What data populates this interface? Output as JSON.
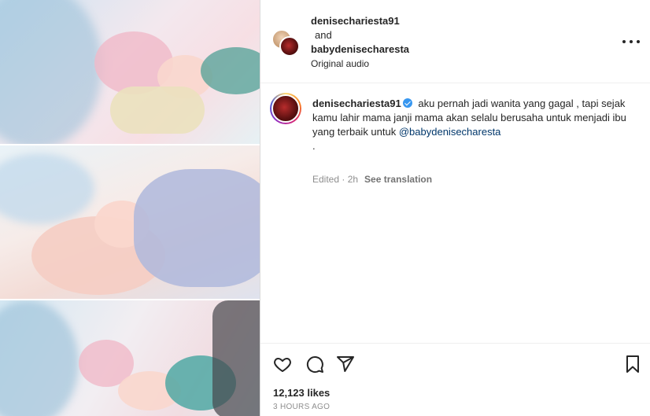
{
  "header": {
    "user1": "denisechariesta91",
    "joiner": "and",
    "user2": "babydenisecharesta",
    "audio": "Original audio"
  },
  "caption": {
    "username": "denisechariesta91",
    "text": "aku pernah jadi wanita yang gagal , tapi sejak kamu lahir mama janji mama akan selalu berusaha untuk menjadi ibu yang terbaik untuk",
    "mention": "@babydenisecharesta",
    "trailing": "."
  },
  "meta": {
    "edited": "Edited · 2h",
    "see_translation": "See translation"
  },
  "stats": {
    "likes": "12,123 likes",
    "time": "3 HOURS AGO"
  },
  "icons": [
    "more-icon",
    "verified-icon",
    "heart-icon",
    "comment-icon",
    "share-icon",
    "bookmark-icon"
  ]
}
